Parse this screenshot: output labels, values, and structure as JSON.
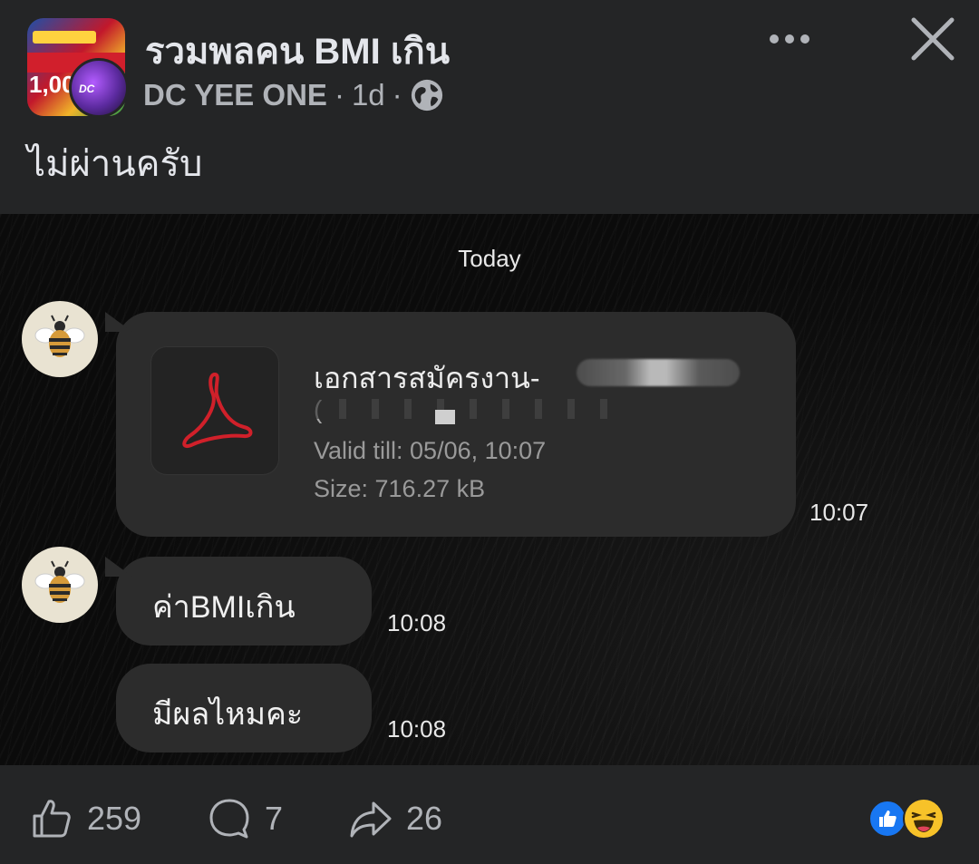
{
  "post": {
    "group_name": "รวมพลคน BMI เกิน",
    "author": "DC YEE ONE",
    "separator": "·",
    "time_ago": "1d",
    "text": "ไม่ผ่านครับ",
    "group_avatar_text": "1,000",
    "user_avatar_text": "DC"
  },
  "chat": {
    "date_label": "Today",
    "file_message": {
      "file_name": "เอกสารสมัครงาน-",
      "file_name_line2": "(",
      "valid_till": "Valid till: 05/06, 10:07",
      "size": "Size: 716.27 kB",
      "time": "10:07",
      "icon": "pdf-icon"
    },
    "messages": [
      {
        "text": "ค่าBMIเกิน",
        "time": "10:08"
      },
      {
        "text": "มีผลไหมคะ",
        "time": "10:08"
      }
    ]
  },
  "footer": {
    "likes": "259",
    "comments": "7",
    "shares": "26",
    "reactions": [
      "like-reaction-icon",
      "haha-reaction-icon"
    ]
  },
  "colors": {
    "background": "#242526",
    "bubble": "#2c2c2c",
    "pdf_red": "#d0202a",
    "like_blue": "#1877f2",
    "haha_yellow": "#f7c229"
  }
}
